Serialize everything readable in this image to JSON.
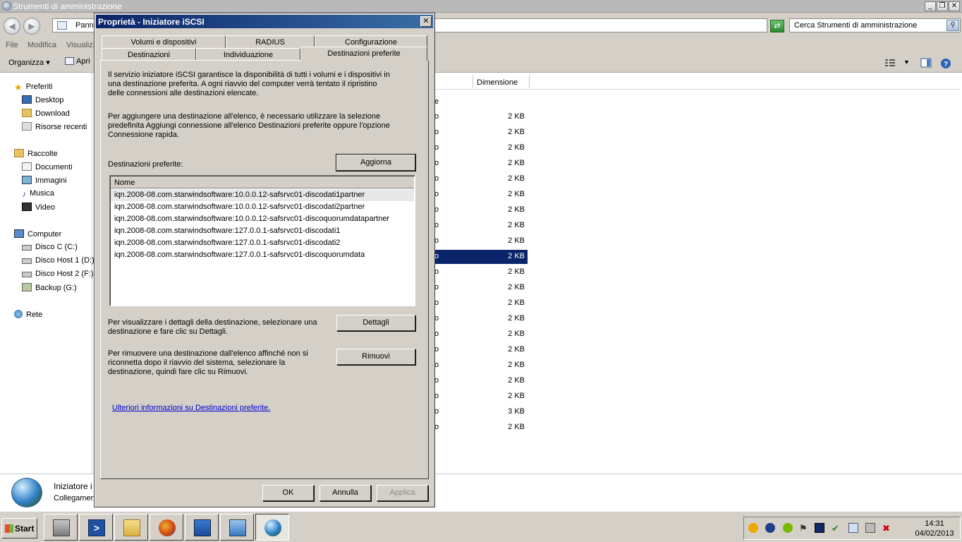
{
  "explorer": {
    "title": "Strumenti di amministrazione",
    "address_text": "Pann",
    "search_placeholder": "Cerca Strumenti di amministrazione",
    "menu": [
      "File",
      "Modifica",
      "Visualizza"
    ],
    "toolbar": {
      "organize": "Organizza",
      "open": "Apri"
    },
    "column_header": "Dimensione",
    "stray_char": "e",
    "nav": {
      "favorites": "Preferiti",
      "favorites_items": [
        "Desktop",
        "Download",
        "Risorse recenti"
      ],
      "libraries": "Raccolte",
      "libraries_items": [
        "Documenti",
        "Immagini",
        "Musica",
        "Video"
      ],
      "computer": "Computer",
      "computer_items": [
        "Disco C (C:)",
        "Disco Host 1 (D:)",
        "Disco Host 2 (F:)",
        "Backup (G:)"
      ],
      "network": "Rete"
    },
    "rows": [
      {
        "c": "o",
        "size": "2 KB"
      },
      {
        "c": "o",
        "size": "2 KB"
      },
      {
        "c": "o",
        "size": "2 KB"
      },
      {
        "c": "o",
        "size": "2 KB"
      },
      {
        "c": "o",
        "size": "2 KB"
      },
      {
        "c": "o",
        "size": "2 KB"
      },
      {
        "c": "o",
        "size": "2 KB"
      },
      {
        "c": "o",
        "size": "2 KB"
      },
      {
        "c": "o",
        "size": "2 KB"
      },
      {
        "c": "o",
        "size": "2 KB"
      },
      {
        "c": "o",
        "size": "2 KB"
      },
      {
        "c": "o",
        "size": "2 KB"
      },
      {
        "c": "o",
        "size": "2 KB"
      },
      {
        "c": "o",
        "size": "2 KB"
      },
      {
        "c": "o",
        "size": "2 KB"
      },
      {
        "c": "o",
        "size": "2 KB"
      },
      {
        "c": "o",
        "size": "2 KB"
      },
      {
        "c": "o",
        "size": "2 KB"
      },
      {
        "c": "o",
        "size": "2 KB"
      },
      {
        "c": "o",
        "size": "3 KB"
      },
      {
        "c": "o",
        "size": "2 KB"
      }
    ],
    "selected_row": 9,
    "details": {
      "title": "Iniziatore i",
      "subtitle": "Collegamen"
    }
  },
  "dialog": {
    "title": "Proprietà - Iniziatore iSCSI",
    "close": "✕",
    "tabs_back": [
      "Volumi e dispositivi",
      "RADIUS",
      "Configurazione"
    ],
    "tabs_front": [
      "Destinazioni",
      "Individuazione",
      "Destinazioni preferite"
    ],
    "active_tab": "Destinazioni preferite",
    "intro_1": "Il servizio iniziatore iSCSI garantisce la disponibilità di tutti i volumi e i dispositivi in una destinazione preferita. A ogni riavvio del computer verrà tentato il ripristino delle connessioni alle destinazioni elencate.",
    "intro_2": "Per aggiungere una destinazione all'elenco, è necessario utilizzare la selezione predefinita Aggiungi connessione all'elenco Destinazioni preferite oppure l'opzione Connessione rapida.",
    "list_label": "Destinazioni preferite:",
    "refresh_btn": "Aggiorna",
    "list_header": "Nome",
    "targets": [
      "iqn.2008-08.com.starwindsoftware:10.0.0.12-safsrvc01-discodati1partner",
      "iqn.2008-08.com.starwindsoftware:10.0.0.12-safsrvc01-discodati2partner",
      "iqn.2008-08.com.starwindsoftware:10.0.0.12-safsrvc01-discoquorumdatapartner",
      "iqn.2008-08.com.starwindsoftware:127.0.0.1-safsrvc01-discodati1",
      "iqn.2008-08.com.starwindsoftware:127.0.0.1-safsrvc01-discodati2",
      "iqn.2008-08.com.starwindsoftware:127.0.0.1-safsrvc01-discoquorumdata"
    ],
    "details_text": "Per visualizzare i dettagli della destinazione, selezionare una destinazione e fare clic su Dettagli.",
    "details_btn": "Dettagli",
    "remove_text": "Per rimuovere una destinazione dall'elenco affinché non si riconnetta dopo il riavvio del sistema, selezionare la destinazione, quindi fare clic su Rimuovi.",
    "remove_btn": "Rimuovi",
    "more_link": "Ulteriori informazioni su Destinazioni preferite.",
    "ok": "OK",
    "cancel": "Annulla",
    "apply": "Applica"
  },
  "taskbar": {
    "start": "Start",
    "time": "14:31",
    "date": "04/02/2013"
  },
  "colors": {
    "dialog_title": "#0a246a",
    "selection": "#0a246a",
    "link": "#0000cc",
    "face": "#d4d0c8"
  }
}
